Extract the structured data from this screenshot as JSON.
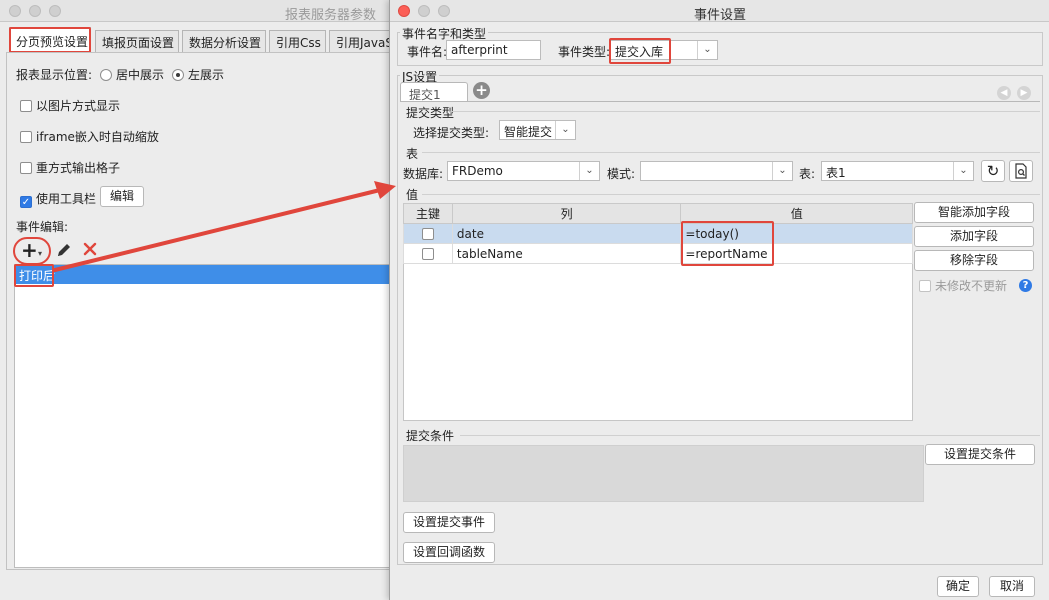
{
  "back_window": {
    "title": "报表服务器参数",
    "tabs": [
      "分页预览设置",
      "填报页面设置",
      "数据分析设置",
      "引用Css",
      "引用JavaS"
    ],
    "display_position_label": "报表显示位置:",
    "radio_center": "居中展示",
    "radio_left": "左展示",
    "options": {
      "image_display": "以图片方式显示",
      "iframe_autoscale": "iframe嵌入时自动缩放",
      "square_cells": "重方式输出格子",
      "use_toolbar": "使用工具栏",
      "edit_button": "编辑"
    },
    "event_edit_label": "事件编辑:",
    "events": [
      "打印后"
    ]
  },
  "dialog": {
    "title": "事件设置",
    "event_group_title": "事件名字和类型",
    "event_name_label": "事件名:",
    "event_name_value": "afterprint",
    "event_type_label": "事件类型:",
    "event_type_value": "提交入库",
    "js_group_title": "JS设置",
    "submit_tab": "提交1",
    "submit_type_title": "提交类型",
    "choose_submit_type_label": "选择提交类型:",
    "submit_type_value": "智能提交",
    "table_section_title": "表",
    "database_label": "数据库:",
    "database_value": "FRDemo",
    "schema_label": "模式:",
    "schema_value": "",
    "table_label": "表:",
    "table_value": "表1",
    "value_section_title": "值",
    "grid_headers": [
      "主键",
      "列",
      "值"
    ],
    "grid_rows": [
      {
        "column": "date",
        "value": "=today()"
      },
      {
        "column": "tableName",
        "value": "=reportName"
      }
    ],
    "smart_add_field": "智能添加字段",
    "add_field": "添加字段",
    "remove_field": "移除字段",
    "no_update_unmodified": "未修改不更新",
    "submit_condition_title": "提交条件",
    "set_submit_condition": "设置提交条件",
    "set_submit_event": "设置提交事件",
    "set_callback": "设置回调函数",
    "ok": "确定",
    "cancel": "取消"
  },
  "colors": {
    "highlight_red": "#e0463c",
    "selection_blue": "#3f8ee8"
  }
}
